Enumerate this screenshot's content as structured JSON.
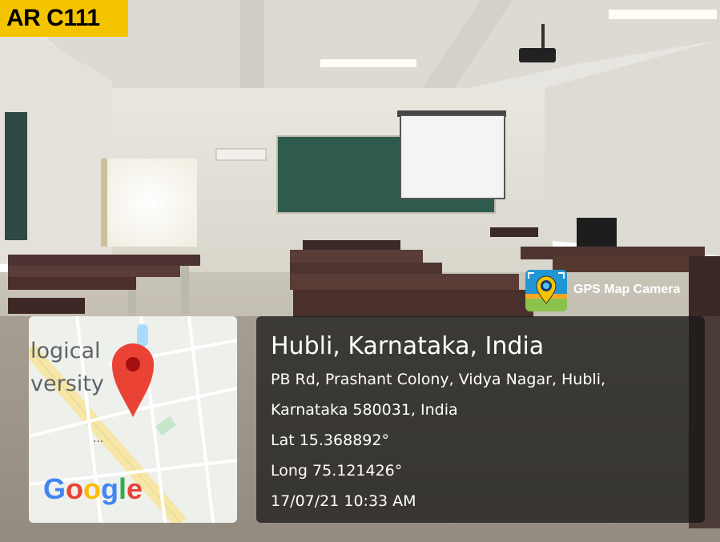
{
  "room_tag": "AR C111",
  "gps_badge": {
    "label": "GPS Map Camera",
    "icon": "gps-map-camera-icon"
  },
  "map": {
    "label_line1": "logical",
    "label_line2": "versity",
    "brand": "Google",
    "ellipsis": "...",
    "pin_icon": "map-pin-icon"
  },
  "location": {
    "city": "Hubli, Karnataka, India",
    "address_line1": "PB Rd, Prashant Colony, Vidya Nagar, Hubli,",
    "address_line2": "Karnataka 580031, India",
    "latitude": "Lat 15.368892°",
    "longitude": "Long 75.121426°",
    "timestamp": "17/07/21 10:33 AM"
  },
  "colors": {
    "tag": "#f5c400",
    "pin": "#ea4335",
    "road": "#f6e7a8",
    "water": "#aadaff"
  }
}
